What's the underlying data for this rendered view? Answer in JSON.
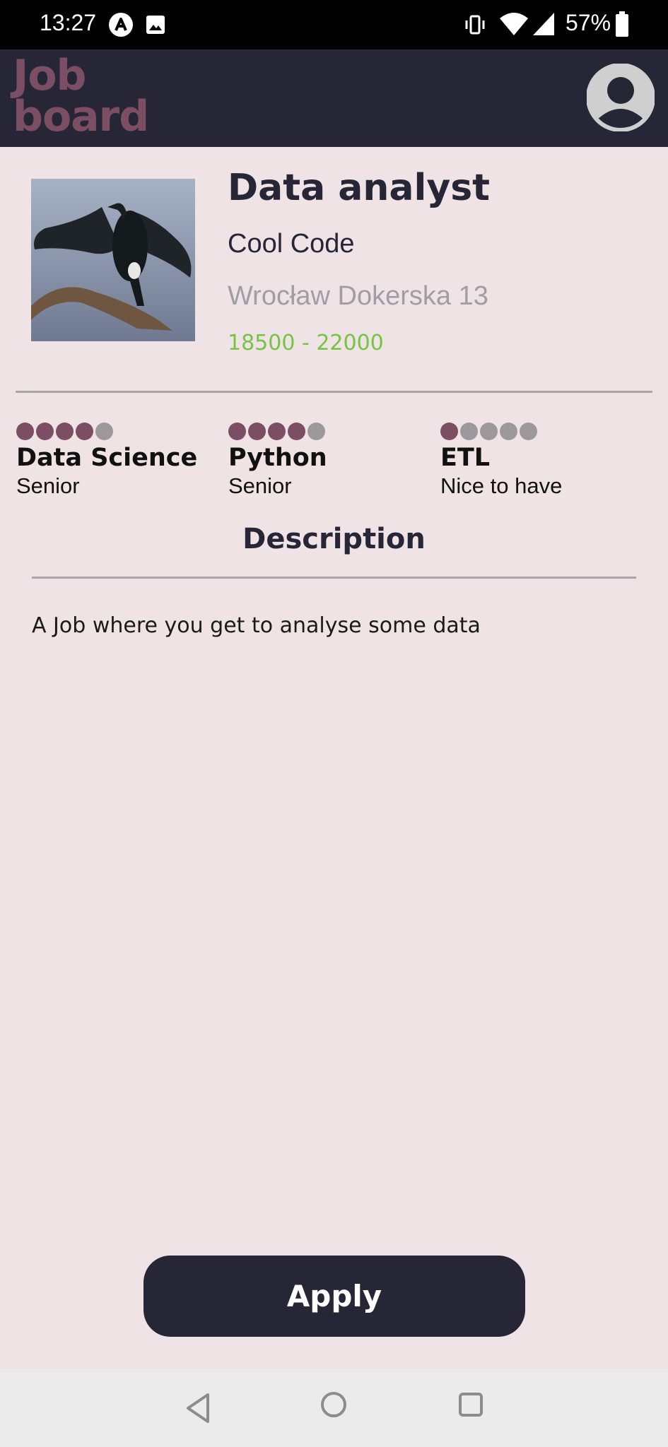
{
  "status_bar": {
    "time": "13:27",
    "battery": "57%",
    "icons": [
      "app-a-icon",
      "image-icon",
      "vibrate-icon",
      "wifi-icon",
      "signal-icon",
      "battery-icon"
    ]
  },
  "header": {
    "logo_line1": "Job",
    "logo_line2": "board",
    "avatar_icon": "user-avatar-icon"
  },
  "job": {
    "title": "Data analyst",
    "company": "Cool Code",
    "address": "Wrocław Dokerska 13",
    "salary": "18500 - 22000",
    "image": "cormorant-photo"
  },
  "skills": [
    {
      "name": "Data Science",
      "level": "Senior",
      "rating": 4,
      "max": 5
    },
    {
      "name": "Python",
      "level": "Senior",
      "rating": 4,
      "max": 5
    },
    {
      "name": "ETL",
      "level": "Nice to have",
      "rating": 1,
      "max": 5
    }
  ],
  "description": {
    "heading": "Description",
    "text": "A Job where you get to analyse some data"
  },
  "apply_button": "Apply",
  "colors": {
    "header_bg": "#272637",
    "page_bg": "#efe3e6",
    "brand": "#7b4e63",
    "salary": "#76c442",
    "muted": "#a09da4"
  },
  "nav": {
    "icons": [
      "back-icon",
      "home-icon",
      "recents-icon"
    ]
  }
}
